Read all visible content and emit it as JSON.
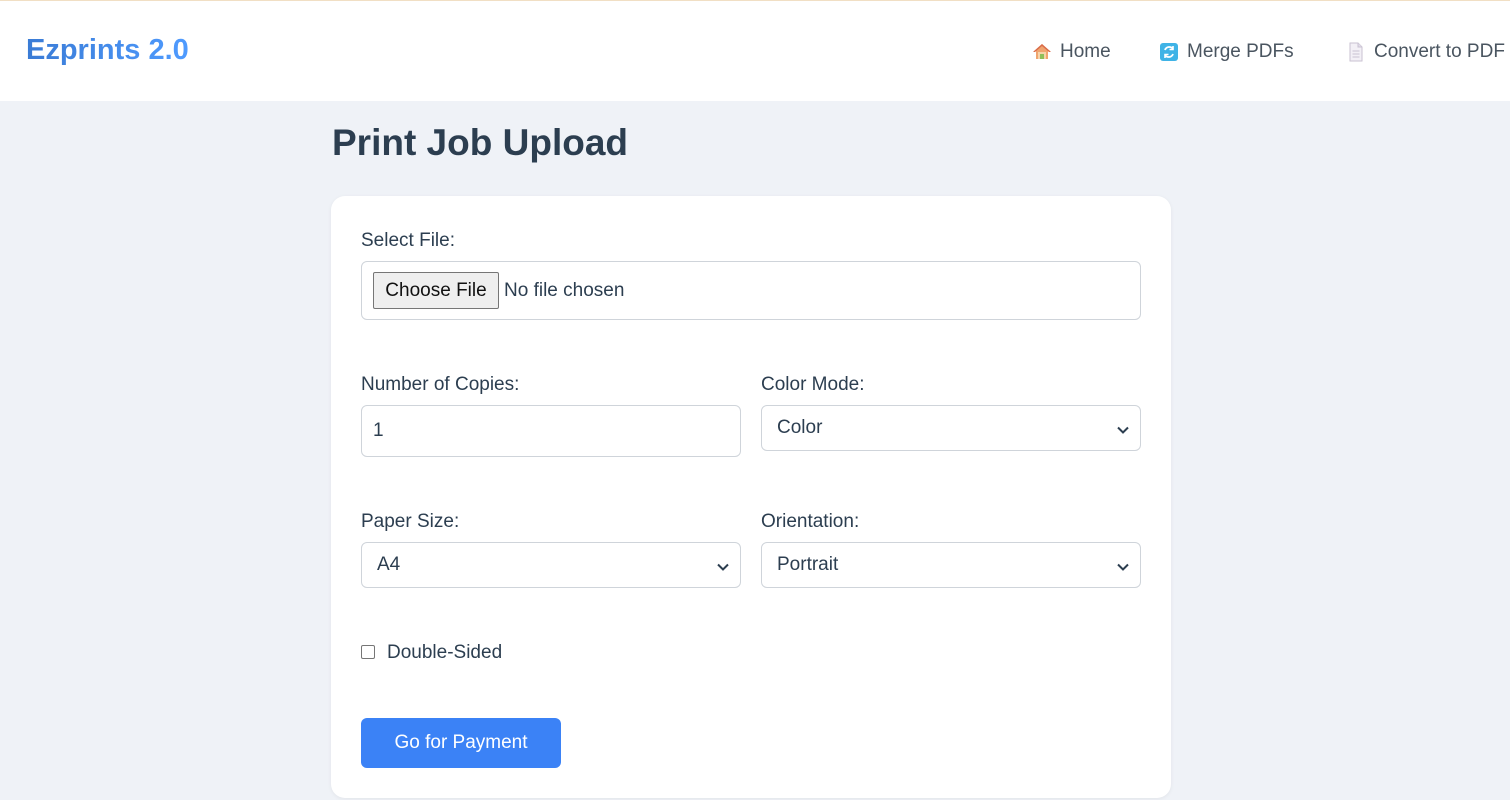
{
  "app": {
    "brand": "Ezprints 2.0"
  },
  "nav": {
    "items": [
      {
        "label": "Home",
        "icon": "home-icon"
      },
      {
        "label": "Merge PDFs",
        "icon": "merge-icon"
      },
      {
        "label": "Convert to PDF",
        "icon": "document-icon"
      }
    ]
  },
  "page": {
    "title": "Print Job Upload"
  },
  "form": {
    "file": {
      "label": "Select File:",
      "button_label": "Choose File",
      "status": "No file chosen"
    },
    "copies": {
      "label": "Number of Copies:",
      "value": "1"
    },
    "color_mode": {
      "label": "Color Mode:",
      "selected": "Color"
    },
    "paper_size": {
      "label": "Paper Size:",
      "selected": "A4"
    },
    "orientation": {
      "label": "Orientation:",
      "selected": "Portrait"
    },
    "double_sided": {
      "label": "Double-Sided",
      "checked": false
    },
    "submit_label": "Go for Payment"
  },
  "colors": {
    "accent": "#3b82f6",
    "brand_gradient_start": "#3a7bd5",
    "brand_gradient_end": "#4f9bff",
    "background": "#eff2f7",
    "text": "#2c3e50"
  }
}
